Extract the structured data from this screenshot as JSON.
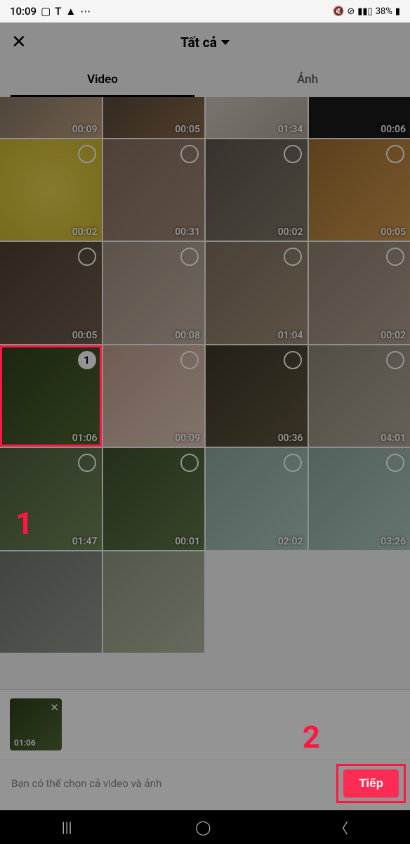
{
  "status_bar": {
    "time": "10:09",
    "battery": "38%"
  },
  "header": {
    "title": "Tất cả"
  },
  "tabs": {
    "video": "Video",
    "photo": "Ảnh"
  },
  "grid_items": [
    {
      "duration": "00:09",
      "selectable": false
    },
    {
      "duration": "00:05",
      "selectable": false
    },
    {
      "duration": "01:34",
      "selectable": false
    },
    {
      "duration": "00:06",
      "selectable": false
    },
    {
      "duration": "00:02",
      "selectable": true
    },
    {
      "duration": "00:31",
      "selectable": true
    },
    {
      "duration": "00:02",
      "selectable": true
    },
    {
      "duration": "00:05",
      "selectable": true
    },
    {
      "duration": "00:05",
      "selectable": true
    },
    {
      "duration": "00:08",
      "selectable": true
    },
    {
      "duration": "01:04",
      "selectable": true
    },
    {
      "duration": "00:02",
      "selectable": true
    },
    {
      "duration": "01:06",
      "selectable": true,
      "selected_order": "1"
    },
    {
      "duration": "00:09",
      "selectable": true
    },
    {
      "duration": "00:36",
      "selectable": true
    },
    {
      "duration": "04:01",
      "selectable": true
    },
    {
      "duration": "01:47",
      "selectable": true
    },
    {
      "duration": "00:01",
      "selectable": true
    },
    {
      "duration": "02:02",
      "selectable": true
    },
    {
      "duration": "03:26",
      "selectable": true
    },
    {
      "duration": "",
      "selectable": false
    },
    {
      "duration": "",
      "selectable": false
    }
  ],
  "selected_preview": {
    "duration": "01:06"
  },
  "hint": "Bạn có thể chọn cả video và ảnh",
  "next_label": "Tiếp",
  "annotations": {
    "step1": "1",
    "step2": "2"
  }
}
